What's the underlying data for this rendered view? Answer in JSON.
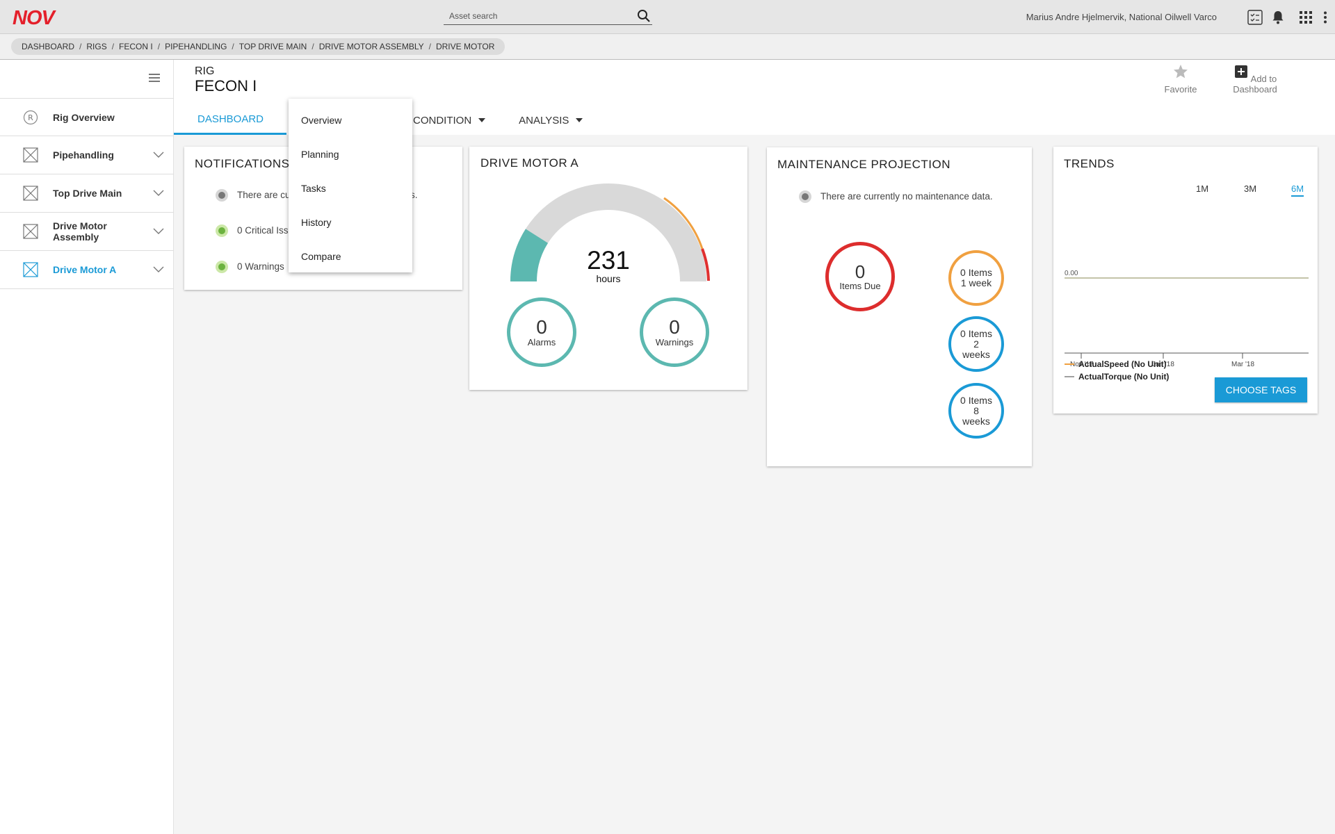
{
  "topbar": {
    "logo_text": "NOV",
    "search_placeholder": "Asset search",
    "user": "Marius Andre Hjelmervik, National Oilwell Varco",
    "brand_color": "#e4202b"
  },
  "breadcrumb": [
    "DASHBOARD",
    "RIGS",
    "FECON I",
    "PIPEHANDLING",
    "TOP DRIVE MAIN",
    "DRIVE MOTOR ASSEMBLY",
    "DRIVE MOTOR"
  ],
  "sidebar": {
    "items": [
      {
        "label": "Rig Overview",
        "icon": "r-circle-icon"
      },
      {
        "label": "Pipehandling",
        "icon": "crossed-box-icon"
      },
      {
        "label": "Top Drive Main",
        "icon": "crossed-box-icon"
      },
      {
        "label": "Drive Motor Assembly",
        "icon": "crossed-box-icon"
      },
      {
        "label": "Drive Motor A",
        "icon": "crossed-box-icon",
        "active": true
      }
    ]
  },
  "header": {
    "rig_label": "RIG",
    "rig_name": "FECON I",
    "favorite_label": "Favorite",
    "add_dashboard_label": "Add to Dashboard",
    "tabs": [
      "DASHBOARD",
      "CONDITION",
      "ANALYSIS"
    ]
  },
  "menu": {
    "items": [
      "Overview",
      "Planning",
      "Tasks",
      "History",
      "Compare"
    ]
  },
  "notifications": {
    "title": "NOTIFICATIONS",
    "line1": "There are cu",
    "line1_tail": "s.",
    "critical": "0 Critical Iss",
    "warnings": "0 Warnings"
  },
  "drive_motor": {
    "title": "DRIVE MOTOR A",
    "hours_value": "231",
    "hours_unit": "hours",
    "alarms_value": "0",
    "alarms_label": "Alarms",
    "warnings_value": "0",
    "warnings_label": "Warnings",
    "gauge_fraction": 0.18,
    "accent": "#5cb8b0"
  },
  "maintenance": {
    "title": "MAINTENANCE PROJECTION",
    "note": "There are currently no maintenance data.",
    "due_value": "0",
    "due_label": "Items Due",
    "week1": [
      "0 Items",
      "1 week"
    ],
    "week2": [
      "0 Items",
      "2",
      "weeks"
    ],
    "week8": [
      "0 Items",
      "8",
      "weeks"
    ]
  },
  "trends": {
    "title": "TRENDS",
    "ranges": [
      "1M",
      "3M",
      "6M"
    ],
    "active_range": "6M",
    "choose_tags": "CHOOSE TAGS"
  },
  "chart_data": {
    "type": "line",
    "x_ticks": [
      "Nov '17",
      "Jan '18",
      "Mar '18"
    ],
    "y_tick": "0.00",
    "series": [
      {
        "name": "ActualSpeed (No Unit)",
        "color": "#f0a040",
        "values": [
          0,
          0,
          0
        ]
      },
      {
        "name": "ActualTorque (No Unit)",
        "color": "#a0a0a0",
        "values": [
          0,
          0,
          0
        ]
      }
    ]
  }
}
